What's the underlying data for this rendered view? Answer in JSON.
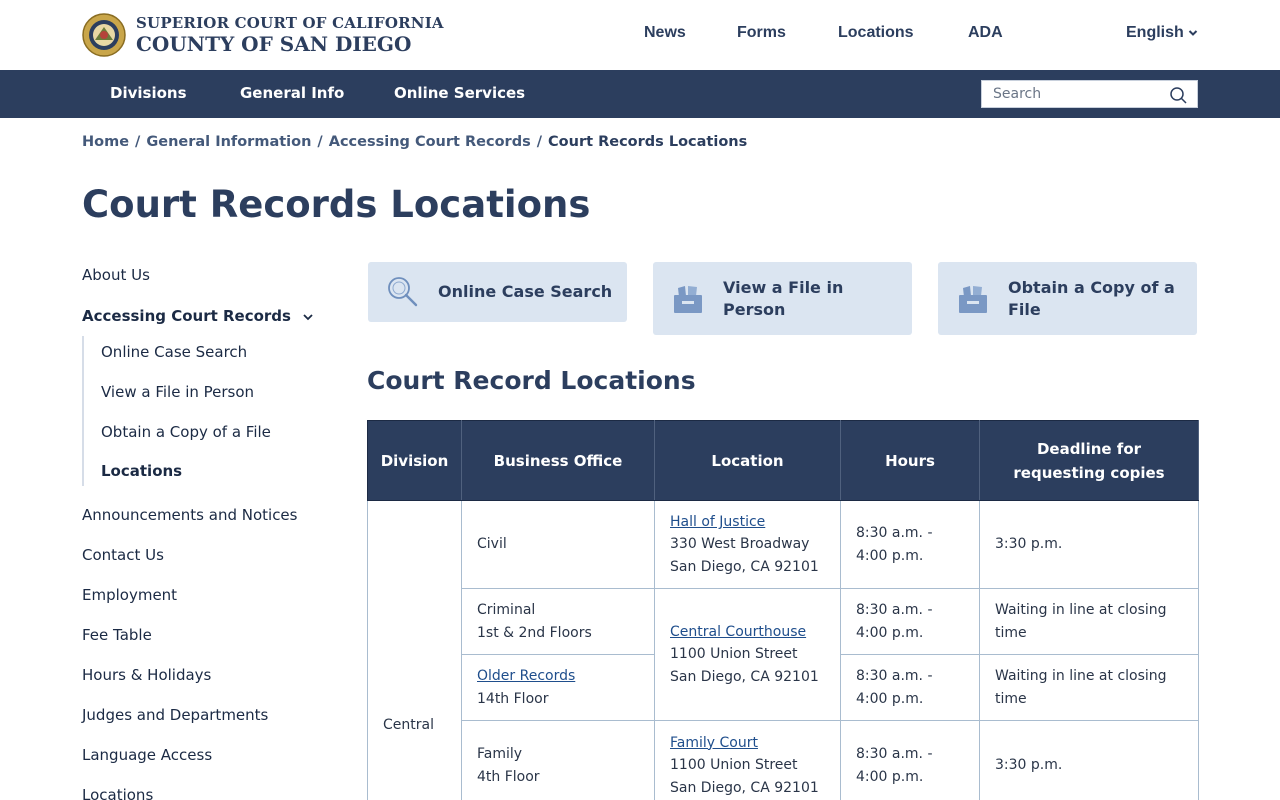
{
  "header": {
    "brand_line1": "SUPERIOR COURT OF CALIFORNIA",
    "brand_line2": "COUNTY OF SAN DIEGO",
    "top_nav": [
      "News",
      "Forms",
      "Locations",
      "ADA"
    ],
    "language": "English"
  },
  "main_nav": {
    "items": [
      "Divisions",
      "General Info",
      "Online Services"
    ],
    "search_placeholder": "Search"
  },
  "breadcrumb": {
    "items": [
      "Home",
      "General Information",
      "Accessing Court Records"
    ],
    "current": "Court Records Locations",
    "separator": "/"
  },
  "page_title": "Court Records Locations",
  "sidebar": {
    "items": [
      "About Us",
      "Accessing Court Records",
      "Announcements and Notices",
      "Contact Us",
      "Employment",
      "Fee Table",
      "Hours & Holidays",
      "Judges and Departments",
      "Language Access",
      "Locations"
    ],
    "subitems": [
      "Online Case Search",
      "View a File in Person",
      "Obtain a Copy of a File",
      "Locations"
    ]
  },
  "cards": [
    {
      "label": "Online Case Search",
      "icon": "magnifier-icon"
    },
    {
      "label": "View a File in Person",
      "icon": "file-box-icon"
    },
    {
      "label": "Obtain a Copy of a File",
      "icon": "file-box-icon"
    }
  ],
  "section_title": "Court Record Locations",
  "table": {
    "headers": [
      "Division",
      "Business Office",
      "Location",
      "Hours",
      "Deadline for requesting copies"
    ],
    "division": "Central",
    "rows": [
      {
        "office": "Civil",
        "office_sub": "",
        "office_link": "",
        "loc_link": "Hall of Justice",
        "loc_addr1": "330 West Broadway",
        "loc_addr2": "San Diego, CA 92101",
        "hours1": "8:30 a.m. -",
        "hours2": "4:00 p.m.",
        "deadline": "3:30 p.m."
      },
      {
        "office": "Criminal",
        "office_sub": "1st & 2nd Floors",
        "hours1": "8:30 a.m. -",
        "hours2": "4:00 p.m.",
        "deadline": "Waiting in line at closing time"
      },
      {
        "office_link": "Older Records",
        "office_sub": "14th Floor",
        "hours1": "8:30 a.m. -",
        "hours2": "4:00 p.m.",
        "deadline": "Waiting in line at closing time"
      },
      {
        "office": "Family",
        "office_sub": "4th Floor",
        "loc_link": "Family Court",
        "loc_addr1": "1100 Union Street",
        "loc_addr2": "San Diego, CA 92101",
        "hours1": "8:30 a.m. -",
        "hours2": "4:00 p.m.",
        "deadline": "3:30 p.m."
      }
    ],
    "central_courthouse": {
      "link": "Central Courthouse",
      "addr1": "1100 Union Street",
      "addr2": "San Diego, CA 92101"
    }
  },
  "colors": {
    "navy": "#2c3e5e",
    "card_bg": "#dbe5f1",
    "link": "#1f4e8c",
    "border": "#a9bccf"
  }
}
